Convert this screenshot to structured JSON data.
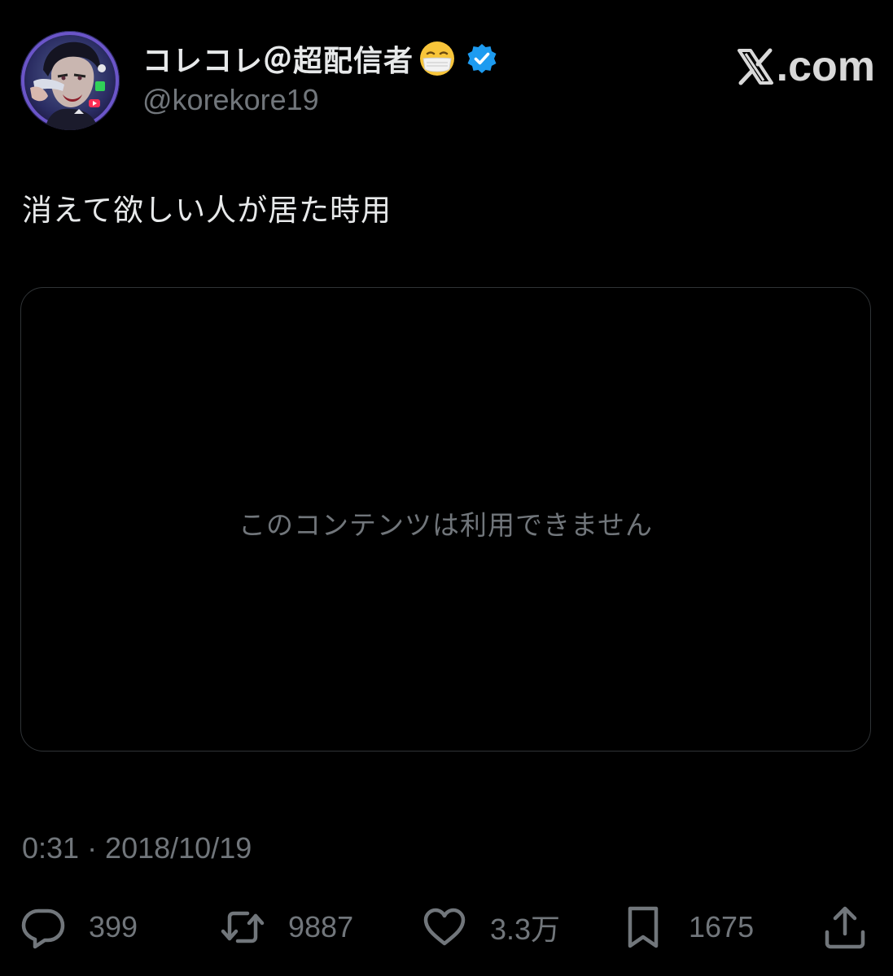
{
  "author": {
    "display_name": "コレコレ＠超配信者",
    "handle": "@korekore19",
    "verified": true,
    "emoji": "face-with-medical-mask",
    "avatar": "avatar-illustration"
  },
  "site": {
    "logo_suffix": ".com",
    "logo_icon": "x-logo-icon"
  },
  "tweet": {
    "text": "消えて欲しい人が居た時用",
    "media_unavailable_text": "このコンテンツは利用できません",
    "timestamp": "0:31 · 2018/10/19"
  },
  "actions": {
    "reply": {
      "icon": "reply-icon",
      "count": "399"
    },
    "retweet": {
      "icon": "retweet-icon",
      "count": "9887"
    },
    "like": {
      "icon": "heart-icon",
      "count": "3.3万"
    },
    "bookmark": {
      "icon": "bookmark-icon",
      "count": "1675"
    },
    "share": {
      "icon": "share-icon"
    }
  },
  "colors": {
    "background": "#000000",
    "primary_text": "#e7e9ea",
    "secondary_text": "#71767b",
    "verified_blue": "#1d9bf0",
    "card_border": "#2f3336"
  }
}
